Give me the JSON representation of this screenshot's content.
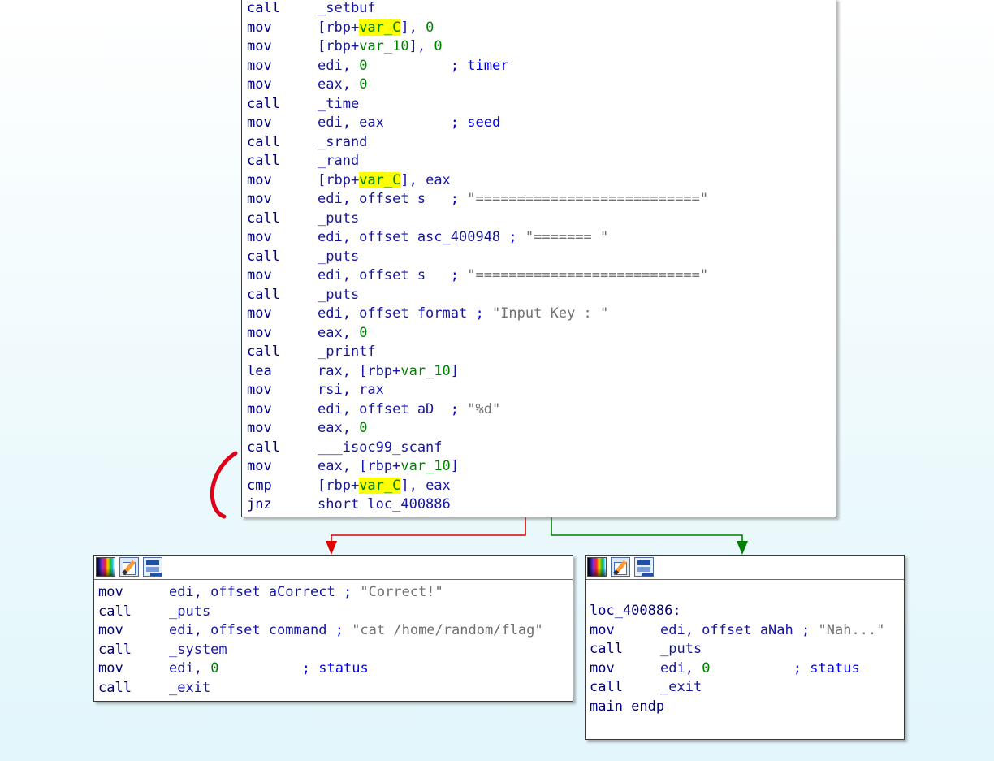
{
  "main_block": {
    "lines": [
      {
        "mnem": "call",
        "parts": [
          {
            "t": "_setbuf",
            "c": "sym"
          }
        ]
      },
      {
        "mnem": "mov",
        "parts": [
          {
            "t": "[rbp+",
            "c": "sym"
          },
          {
            "t": "var_C",
            "c": "grn hl"
          },
          {
            "t": "], ",
            "c": "sym"
          },
          {
            "t": "0",
            "c": "num"
          }
        ]
      },
      {
        "mnem": "mov",
        "parts": [
          {
            "t": "[rbp+",
            "c": "sym"
          },
          {
            "t": "var_10",
            "c": "grn"
          },
          {
            "t": "], ",
            "c": "sym"
          },
          {
            "t": "0",
            "c": "num"
          }
        ]
      },
      {
        "mnem": "mov",
        "parts": [
          {
            "t": "edi, ",
            "c": "sym"
          },
          {
            "t": "0",
            "c": "num"
          },
          {
            "t": "          ",
            "c": "sym"
          },
          {
            "t": "; timer",
            "c": "cmt"
          }
        ]
      },
      {
        "mnem": "mov",
        "parts": [
          {
            "t": "eax, ",
            "c": "sym"
          },
          {
            "t": "0",
            "c": "num"
          }
        ]
      },
      {
        "mnem": "call",
        "parts": [
          {
            "t": "_time",
            "c": "sym"
          }
        ]
      },
      {
        "mnem": "mov",
        "parts": [
          {
            "t": "edi, eax        ",
            "c": "sym"
          },
          {
            "t": "; seed",
            "c": "cmt"
          }
        ]
      },
      {
        "mnem": "call",
        "parts": [
          {
            "t": "_srand",
            "c": "sym"
          }
        ]
      },
      {
        "mnem": "call",
        "parts": [
          {
            "t": "_rand",
            "c": "sym"
          }
        ]
      },
      {
        "mnem": "mov",
        "parts": [
          {
            "t": "[rbp+",
            "c": "sym"
          },
          {
            "t": "var_C",
            "c": "grn hl"
          },
          {
            "t": "], eax",
            "c": "sym"
          }
        ]
      },
      {
        "mnem": "mov",
        "parts": [
          {
            "t": "edi, offset s   ",
            "c": "sym"
          },
          {
            "t": "; ",
            "c": "cmt"
          },
          {
            "t": "\"===========================\"",
            "c": "str"
          }
        ]
      },
      {
        "mnem": "call",
        "parts": [
          {
            "t": "_puts",
            "c": "sym"
          }
        ]
      },
      {
        "mnem": "mov",
        "parts": [
          {
            "t": "edi, offset asc_400948 ",
            "c": "sym"
          },
          {
            "t": "; ",
            "c": "cmt"
          },
          {
            "t": "\"======= \"",
            "c": "str"
          }
        ]
      },
      {
        "mnem": "call",
        "parts": [
          {
            "t": "_puts",
            "c": "sym"
          }
        ]
      },
      {
        "mnem": "mov",
        "parts": [
          {
            "t": "edi, offset s   ",
            "c": "sym"
          },
          {
            "t": "; ",
            "c": "cmt"
          },
          {
            "t": "\"===========================\"",
            "c": "str"
          }
        ]
      },
      {
        "mnem": "call",
        "parts": [
          {
            "t": "_puts",
            "c": "sym"
          }
        ]
      },
      {
        "mnem": "mov",
        "parts": [
          {
            "t": "edi, offset format ",
            "c": "sym"
          },
          {
            "t": "; ",
            "c": "cmt"
          },
          {
            "t": "\"Input Key : \"",
            "c": "str"
          }
        ]
      },
      {
        "mnem": "mov",
        "parts": [
          {
            "t": "eax, ",
            "c": "sym"
          },
          {
            "t": "0",
            "c": "num"
          }
        ]
      },
      {
        "mnem": "call",
        "parts": [
          {
            "t": "_printf",
            "c": "sym"
          }
        ]
      },
      {
        "mnem": "lea",
        "parts": [
          {
            "t": "rax, [rbp+",
            "c": "sym"
          },
          {
            "t": "var_10",
            "c": "grn"
          },
          {
            "t": "]",
            "c": "sym"
          }
        ]
      },
      {
        "mnem": "mov",
        "parts": [
          {
            "t": "rsi, rax",
            "c": "sym"
          }
        ]
      },
      {
        "mnem": "mov",
        "parts": [
          {
            "t": "edi, offset aD  ",
            "c": "sym"
          },
          {
            "t": "; ",
            "c": "cmt"
          },
          {
            "t": "\"%d\"",
            "c": "str"
          }
        ]
      },
      {
        "mnem": "mov",
        "parts": [
          {
            "t": "eax, ",
            "c": "sym"
          },
          {
            "t": "0",
            "c": "num"
          }
        ]
      },
      {
        "mnem": "call",
        "parts": [
          {
            "t": "___isoc99_scanf",
            "c": "sym"
          }
        ]
      },
      {
        "mnem": "mov",
        "parts": [
          {
            "t": "eax, [rbp+",
            "c": "sym"
          },
          {
            "t": "var_10",
            "c": "grn"
          },
          {
            "t": "]",
            "c": "sym"
          }
        ]
      },
      {
        "mnem": "cmp",
        "parts": [
          {
            "t": "[rbp+",
            "c": "sym"
          },
          {
            "t": "var_C",
            "c": "grn hl"
          },
          {
            "t": "], eax",
            "c": "sym"
          }
        ]
      },
      {
        "mnem": "jnz",
        "parts": [
          {
            "t": "short loc_400886",
            "c": "sym"
          }
        ]
      }
    ]
  },
  "left_block": {
    "lines": [
      {
        "mnem": "mov",
        "parts": [
          {
            "t": "edi, offset aCorrect ",
            "c": "sym"
          },
          {
            "t": "; ",
            "c": "cmt"
          },
          {
            "t": "\"Correct!\"",
            "c": "str"
          }
        ]
      },
      {
        "mnem": "call",
        "parts": [
          {
            "t": "_puts",
            "c": "sym"
          }
        ]
      },
      {
        "mnem": "mov",
        "parts": [
          {
            "t": "edi, offset command ",
            "c": "sym"
          },
          {
            "t": "; ",
            "c": "cmt"
          },
          {
            "t": "\"cat /home/random/flag\"",
            "c": "str"
          }
        ]
      },
      {
        "mnem": "call",
        "parts": [
          {
            "t": "_system",
            "c": "sym"
          }
        ]
      },
      {
        "mnem": "mov",
        "parts": [
          {
            "t": "edi, ",
            "c": "sym"
          },
          {
            "t": "0",
            "c": "num"
          },
          {
            "t": "          ",
            "c": "sym"
          },
          {
            "t": "; status",
            "c": "cmt"
          }
        ]
      },
      {
        "mnem": "call",
        "parts": [
          {
            "t": "_exit",
            "c": "sym"
          }
        ]
      }
    ]
  },
  "right_block": {
    "lines": [
      {
        "label": "loc_400886:"
      },
      {
        "mnem": "mov",
        "parts": [
          {
            "t": "edi, offset aNah ",
            "c": "sym"
          },
          {
            "t": "; ",
            "c": "cmt"
          },
          {
            "t": "\"Nah...\"",
            "c": "str"
          }
        ]
      },
      {
        "mnem": "call",
        "parts": [
          {
            "t": "_puts",
            "c": "sym"
          }
        ]
      },
      {
        "mnem": "mov",
        "parts": [
          {
            "t": "edi, ",
            "c": "sym"
          },
          {
            "t": "0",
            "c": "num"
          },
          {
            "t": "          ",
            "c": "sym"
          },
          {
            "t": "; status",
            "c": "cmt"
          }
        ]
      },
      {
        "mnem": "call",
        "parts": [
          {
            "t": "_exit",
            "c": "sym"
          }
        ]
      },
      {
        "label": "main endp"
      }
    ]
  },
  "toolbar_icons": [
    "color-palette-icon",
    "edit-pencil-icon",
    "graph-view-icon"
  ],
  "colors": {
    "edge_false": "#e00000",
    "edge_true": "#008000",
    "annotation": "#e0001a"
  }
}
